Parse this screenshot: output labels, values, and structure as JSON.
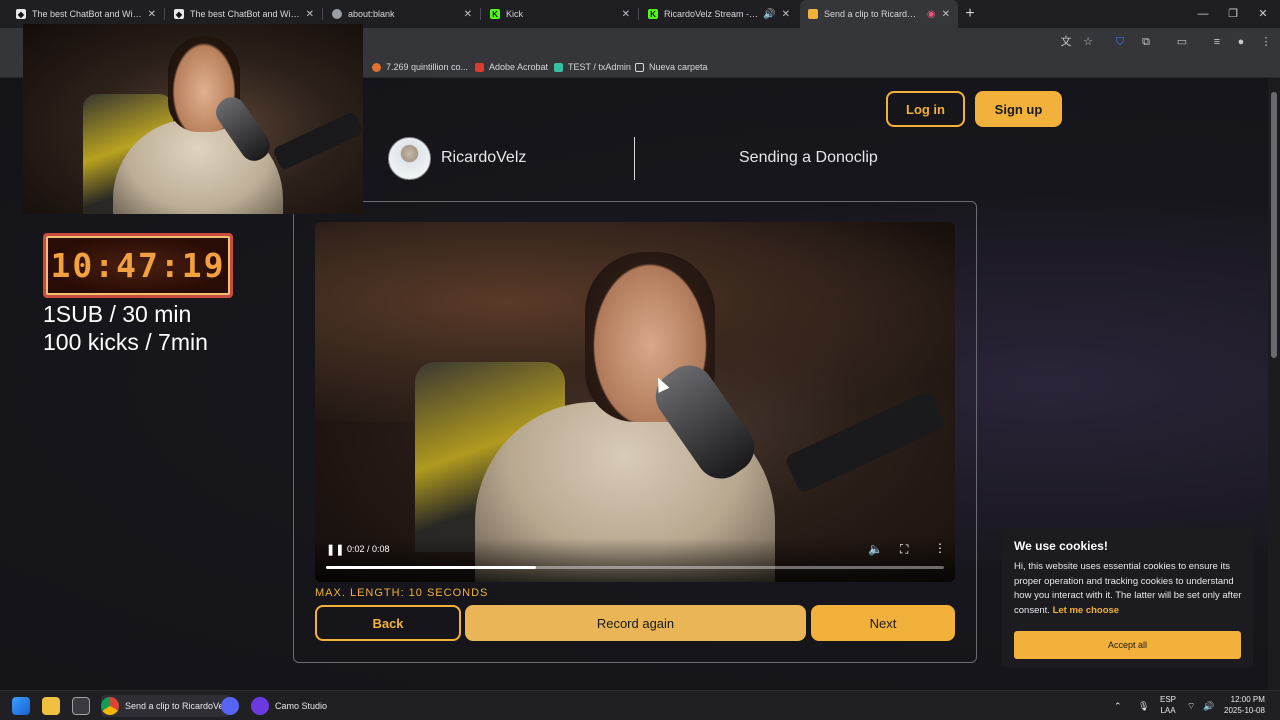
{
  "browser": {
    "tabs": [
      {
        "label": "The best ChatBot and Widgets",
        "favicon": "streamelements-icon",
        "color": "#e8e8ec"
      },
      {
        "label": "The best ChatBot and Widgets",
        "favicon": "streamelements-icon",
        "color": "#e8e8ec"
      },
      {
        "label": "about:blank",
        "favicon": "globe-icon",
        "color": "#9aa0a6"
      },
      {
        "label": "Kick",
        "favicon": "kick-icon",
        "color": "#53fc18"
      },
      {
        "label": "RicardoVelz Stream - Watch",
        "favicon": "kick-icon",
        "color": "#53fc18"
      },
      {
        "label": "Send a clip to RicardoVelz |",
        "favicon": "donoclip-icon",
        "color": "#f2b13a"
      }
    ],
    "bookmarks": [
      {
        "label": "7.269 quintillion co...",
        "icon": "flame-icon",
        "color": "#e07030"
      },
      {
        "label": "Adobe Acrobat",
        "icon": "acrobat-icon",
        "color": "#e03a2e"
      },
      {
        "label": "TEST / txAdmin",
        "icon": "txadmin-icon",
        "color": "#35c0a0"
      },
      {
        "label": "Nueva carpeta",
        "icon": "folder-icon",
        "color": "#d8d8dc"
      }
    ]
  },
  "header": {
    "login_label": "Log in",
    "signup_label": "Sign up",
    "streamer_name": "RicardoVelz",
    "heading": "Sending a Donoclip"
  },
  "video": {
    "current_time": "0:02",
    "duration": "0:08",
    "time_readout": "0:02 / 0:08",
    "progress": 0.34
  },
  "form": {
    "max_length": "MAX. LENGTH: 10 SECONDS",
    "back_label": "Back",
    "record_label": "Record again",
    "next_label": "Next"
  },
  "cookies": {
    "title": "We use cookies!",
    "text": "Hi, this website uses essential cookies to ensure its proper operation and tracking cookies to understand how you interact with it. The latter will be set only after consent.",
    "link": "Let me choose",
    "accept_label": "Accept all"
  },
  "overlay": {
    "timer": "10:47:19",
    "goal_1": "1SUB / 30 min",
    "goal_2": "100 kicks / 7min"
  },
  "taskbar": {
    "chrome_label": "Send a clip to RicardoVe",
    "camo_label": "Camo Studio",
    "lang_1": "ESP",
    "lang_2": "LAA",
    "time": "12:00 PM",
    "date": "2025-10-08"
  },
  "colors": {
    "accent": "#f2b13a",
    "background": "#141419"
  }
}
